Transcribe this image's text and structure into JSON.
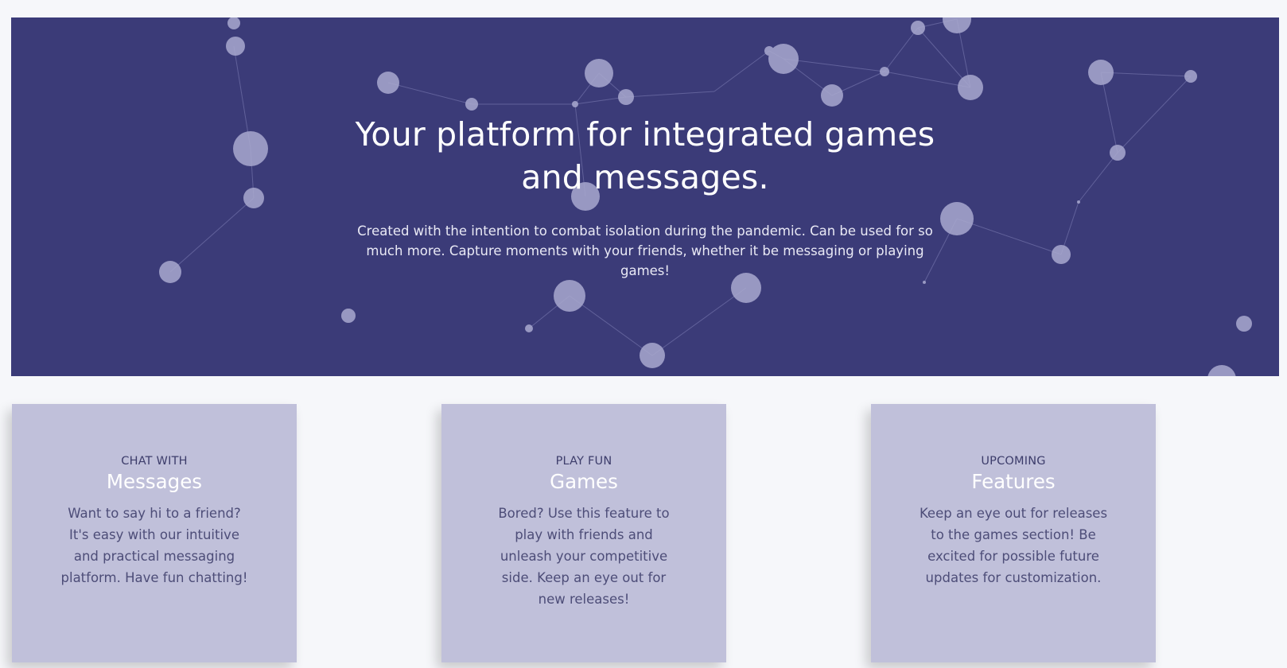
{
  "hero": {
    "title": "Your platform for integrated games and messages.",
    "description": "Created with the intention to combat isolation during the pandemic. Can be used for so much more. Capture moments with your friends, whether it be messaging or playing games!"
  },
  "cards": [
    {
      "kicker": "CHAT WITH",
      "title": "Messages",
      "body": "Want to say hi to a friend? It's easy with our intuitive and practical messaging platform. Have fun chatting!"
    },
    {
      "kicker": "PLAY FUN",
      "title": "Games",
      "body": "Bored? Use this feature to play with friends and unleash your competitive side. Keep an eye out for new releases!"
    },
    {
      "kicker": "UPCOMING",
      "title": "Features",
      "body": "Keep an eye out for releases to the games section! Be excited for possible future updates for customization."
    }
  ],
  "colors": {
    "hero_background": "#3b3b78",
    "card_background": "#c0c0da",
    "particle": "#a9a9cf"
  }
}
